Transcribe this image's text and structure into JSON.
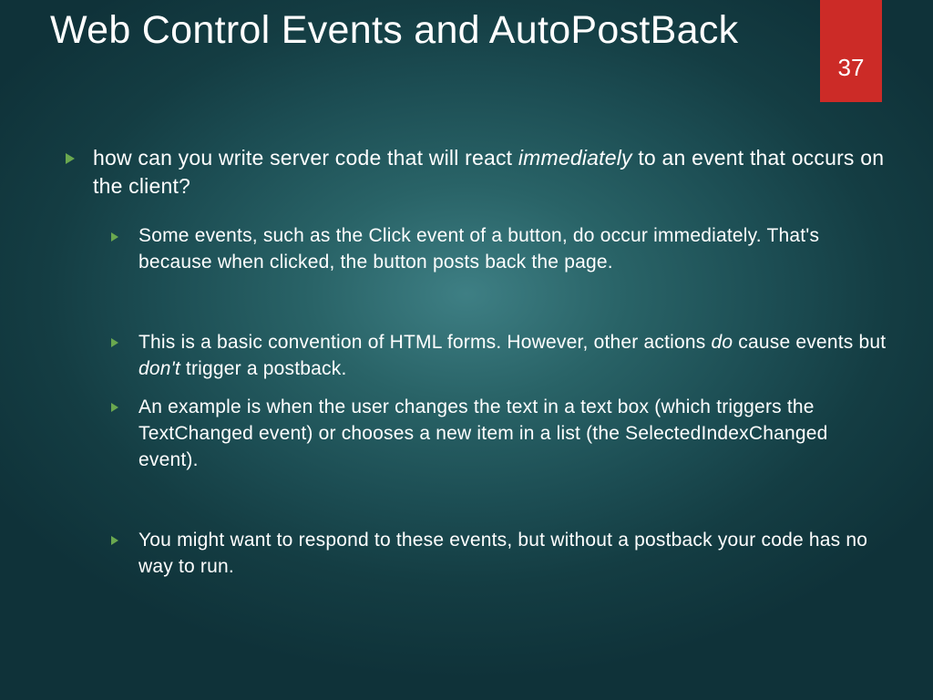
{
  "pageNumber": "37",
  "title": "Web Control Events and AutoPostBack",
  "main": {
    "pre": "how can you write server code that will react ",
    "em": "immediately",
    "post": " to an event that occurs on the client?"
  },
  "sub": [
    {
      "text": "Some events, such as the Click event of a button, do occur immediately. That's because when clicked, the button posts back the page."
    },
    {
      "pre": "This is a basic convention of HTML forms. However, other actions ",
      "em1": "do",
      "mid": " cause events but ",
      "em2": "don't",
      "post": " trigger a postback."
    },
    {
      "text": "An example is when the user changes the text in a text box (which triggers the TextChanged event) or chooses a new item in a list (the SelectedIndexChanged event)."
    },
    {
      "text": "You might want to respond to these events, but without a postback your code has no way to run."
    }
  ]
}
